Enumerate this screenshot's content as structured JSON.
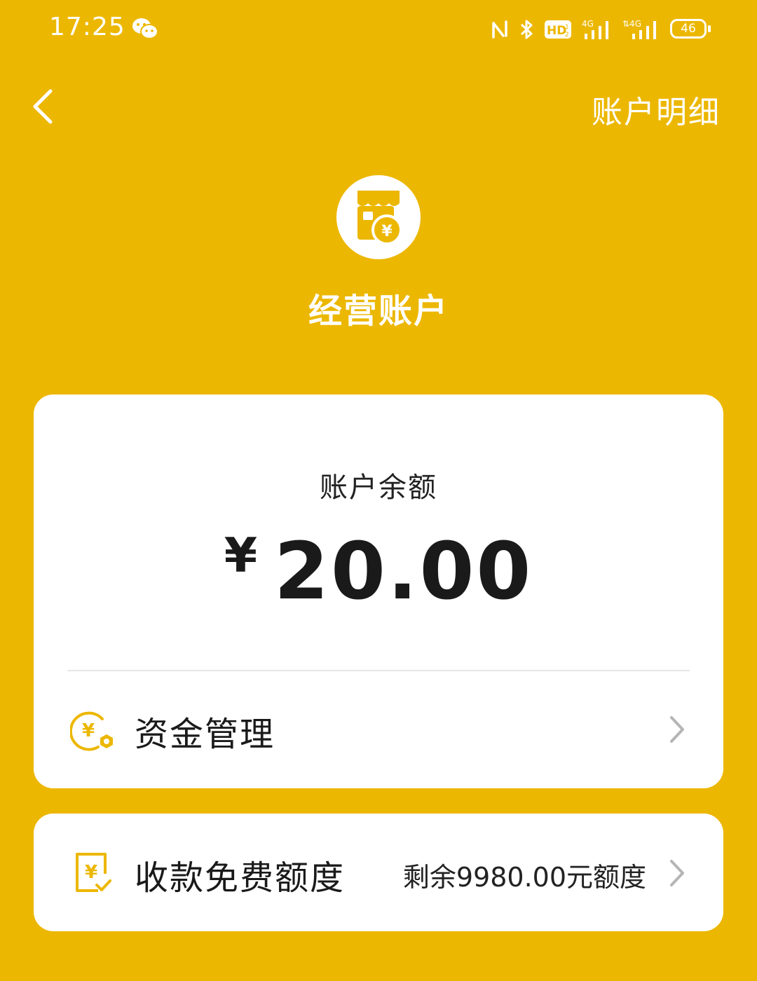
{
  "status_bar": {
    "time": "17:25",
    "battery": "46",
    "icons": [
      "wechat-icon",
      "nfc-icon",
      "bluetooth-icon",
      "hd-volte-icon",
      "signal-4g-1-icon",
      "signal-4g-2-icon",
      "battery-icon"
    ]
  },
  "nav": {
    "back_icon": "chevron-left-icon",
    "action_label": "账户明细"
  },
  "hero": {
    "icon": "shop-yuan-icon",
    "account_name": "经营账户"
  },
  "balance_card": {
    "caption": "账户余额",
    "currency_symbol": "¥",
    "amount": "20.00",
    "fund_management": {
      "label": "资金管理",
      "icon": "yuan-gear-icon"
    }
  },
  "quota_card": {
    "label": "收款免费额度",
    "value": "剩余9980.00元额度",
    "icon": "yuan-receipt-check-icon"
  },
  "colors": {
    "background": "#ECB700",
    "card": "#FFFFFF",
    "accent_icon": "#ECB700",
    "text_primary": "#1A1A1A",
    "chevron": "#B5B5B5"
  }
}
